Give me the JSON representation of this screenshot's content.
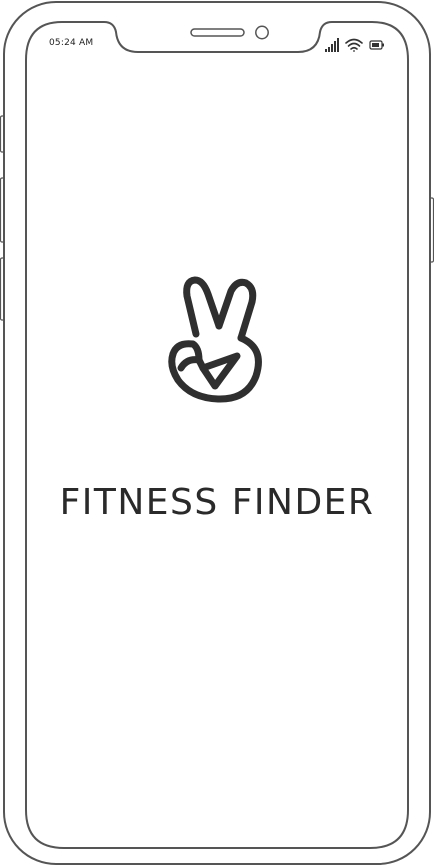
{
  "status_bar": {
    "time": "05:24 AM",
    "icons": [
      "signal-icon",
      "wifi-icon",
      "battery-icon"
    ]
  },
  "splash": {
    "logo_icon": "peace-hand-icon",
    "title": "FITNESS FINDER"
  },
  "colors": {
    "outline": "#4a4a4a",
    "text": "#2a2a2a",
    "background": "#ffffff"
  }
}
